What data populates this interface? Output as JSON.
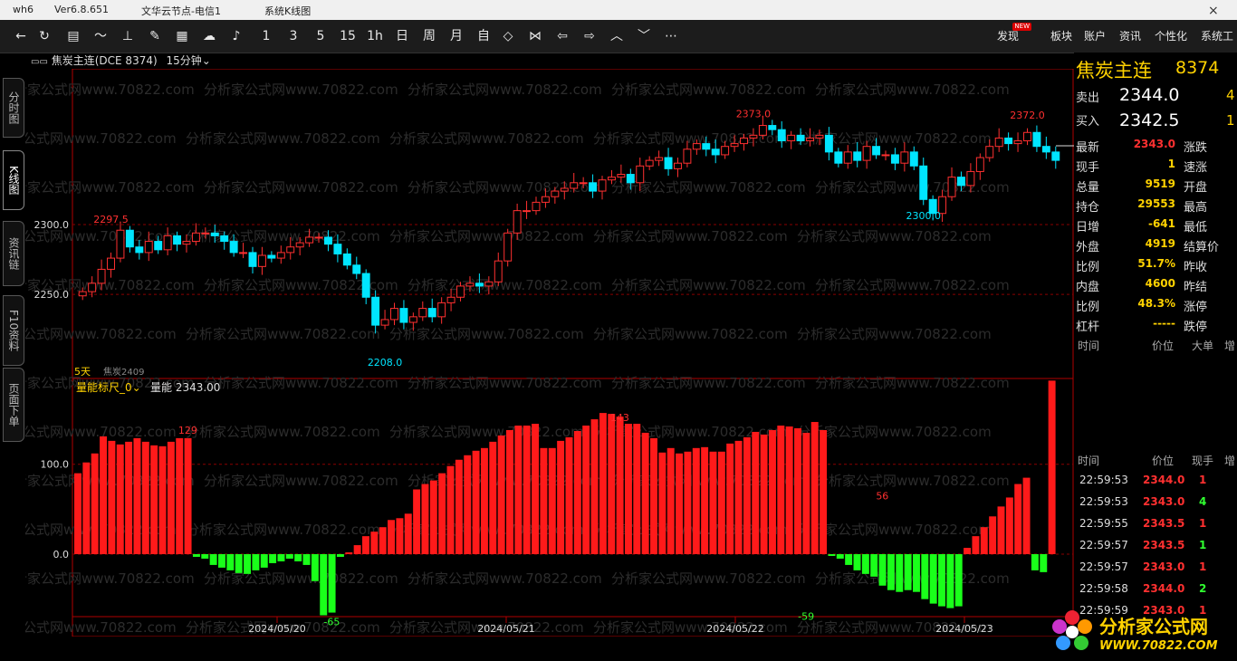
{
  "titlebar": {
    "app": "wh6",
    "version": "Ver6.8.651",
    "server": "文华云节点-电信1",
    "sys": "系统K线图"
  },
  "toolbar": {
    "periods": [
      "1",
      "3",
      "5",
      "15",
      "1h",
      "日",
      "周",
      "月",
      "自"
    ],
    "right": [
      "发现",
      "板块",
      "账户",
      "资讯",
      "个性化",
      "系统工"
    ],
    "new_badge": "NEW"
  },
  "sidetabs": [
    "分时图",
    "K线图",
    "资讯链",
    "F10资料",
    "页面下单"
  ],
  "chart_header": {
    "symbol": "焦炭主连(DCE 8374)",
    "period": "15分钟"
  },
  "indicator": {
    "name": "量能标尺_0",
    "label": "量能",
    "value": "2343.00"
  },
  "contract_note": "焦炭2409",
  "sub_label": "5天",
  "watermark": "分析家公式网www.70822.com",
  "quote": {
    "name": "焦炭主连",
    "code": "8374",
    "sell_label": "卖出",
    "sell": "2344.0",
    "sell_vol": "4",
    "buy_label": "买入",
    "buy": "2342.5",
    "buy_vol": "1",
    "rows": [
      [
        "最新",
        "2343.0",
        "涨跌",
        "red"
      ],
      [
        "现手",
        "1",
        "速涨",
        "yellow"
      ],
      [
        "总量",
        "9519",
        "开盘",
        "yellow"
      ],
      [
        "持仓",
        "29553",
        "最高",
        "yellow"
      ],
      [
        "日增",
        "-641",
        "最低",
        "yellow"
      ],
      [
        "外盘",
        "4919",
        "结算价",
        "yellow"
      ],
      [
        "比例",
        "51.7%",
        "昨收",
        "yellow"
      ],
      [
        "内盘",
        "4600",
        "昨结",
        "yellow"
      ],
      [
        "比例",
        "48.3%",
        "涨停",
        "yellow"
      ],
      [
        "杠杆",
        "-----",
        "跌停",
        "yellow"
      ]
    ],
    "hdr1": [
      "时间",
      "价位",
      "大单",
      "增"
    ],
    "hdr2": [
      "时间",
      "价位",
      "现手",
      "增"
    ],
    "ticks": [
      [
        "22:59:53",
        "2344.0",
        "1"
      ],
      [
        "22:59:53",
        "2343.0",
        "4"
      ],
      [
        "22:59:55",
        "2343.5",
        "1"
      ],
      [
        "22:59:57",
        "2343.5",
        "1"
      ],
      [
        "22:59:57",
        "2343.0",
        "1"
      ],
      [
        "22:59:58",
        "2344.0",
        "2"
      ],
      [
        "22:59:59",
        "2343.0",
        "1"
      ]
    ]
  },
  "logo": {
    "cn": "分析家公式网",
    "url": "WWW.70822.COM"
  },
  "chart_data": {
    "type": "candlestick",
    "y_ticks": [
      2250.0,
      2300.0
    ],
    "ylim": [
      2195,
      2396
    ],
    "annotations": [
      {
        "text": "2297.5",
        "value": 2297.5,
        "i": 3
      },
      {
        "text": "2208.0",
        "value": 2208,
        "i": 32
      },
      {
        "text": "2373.0",
        "value": 2373,
        "i": 71
      },
      {
        "text": "2300.0",
        "value": 2300,
        "i": 89
      },
      {
        "text": "2372.0",
        "value": 2372,
        "i": 100
      }
    ],
    "x_labels": [
      "2024/05/20",
      "2024/05/21",
      "2024/05/22",
      "2024/05/23"
    ],
    "closes": [
      2252,
      2258,
      2268,
      2276,
      2296,
      2284,
      2280,
      2288,
      2282,
      2292,
      2286,
      2288,
      2294,
      2294,
      2292,
      2288,
      2280,
      2280,
      2270,
      2278,
      2276,
      2280,
      2284,
      2287,
      2291,
      2291,
      2286,
      2279,
      2271,
      2265,
      2248,
      2228,
      2232,
      2240,
      2230,
      2234,
      2240,
      2234,
      2244,
      2248,
      2256,
      2258,
      2256,
      2259,
      2274,
      2294,
      2310,
      2310,
      2316,
      2320,
      2324,
      2326,
      2330,
      2330,
      2324,
      2332,
      2334,
      2336,
      2330,
      2342,
      2346,
      2348,
      2340,
      2344,
      2354,
      2358,
      2354,
      2350,
      2356,
      2358,
      2362,
      2364,
      2371,
      2368,
      2360,
      2364,
      2360,
      2362,
      2364,
      2352,
      2344,
      2352,
      2346,
      2356,
      2350,
      2350,
      2344,
      2352,
      2342,
      2318,
      2308,
      2320,
      2334,
      2328,
      2338,
      2348,
      2356,
      2362,
      2358,
      2360,
      2366,
      2356,
      2352,
      2346
    ],
    "volume": [
      [
        90,
        102,
        112,
        131,
        126,
        122,
        125,
        129,
        125,
        121,
        120,
        125,
        129,
        129,
        -3,
        -5,
        -12,
        -15,
        -18,
        -21,
        -22,
        -18,
        -15,
        -10,
        -8,
        -5,
        -8,
        -12,
        -30,
        -68,
        -65,
        -3,
        2,
        10,
        20,
        25,
        30,
        38,
        40,
        45,
        72,
        78,
        82,
        90,
        98,
        105,
        110,
        115,
        118,
        125,
        132,
        138,
        143,
        143,
        145,
        118,
        118,
        126,
        130,
        137,
        143,
        150,
        157,
        156,
        153,
        145,
        145,
        135,
        129,
        113,
        118,
        112,
        114,
        118,
        119,
        114,
        114,
        123,
        126,
        130,
        136,
        133,
        138,
        143,
        142,
        140,
        135,
        147,
        138,
        -2,
        -5,
        -12,
        -18,
        -22,
        -25,
        -35,
        -40,
        -42,
        -40,
        -42,
        -50,
        -55,
        -58,
        -60,
        -58,
        7,
        20,
        30,
        42,
        53,
        63,
        78,
        85,
        -18,
        -20,
        220
      ]
    ],
    "volume_labels": [
      {
        "text": "129",
        "value": 129,
        "i": 13
      },
      {
        "text": "-65",
        "value": -65,
        "i": 30
      },
      {
        "text": "143",
        "value": 143,
        "i": 64
      },
      {
        "text": "-59",
        "value": -59,
        "i": 86
      },
      {
        "text": "56",
        "value": 56,
        "i": 95
      }
    ],
    "vol_ticks": [
      0.0,
      100.0
    ]
  }
}
